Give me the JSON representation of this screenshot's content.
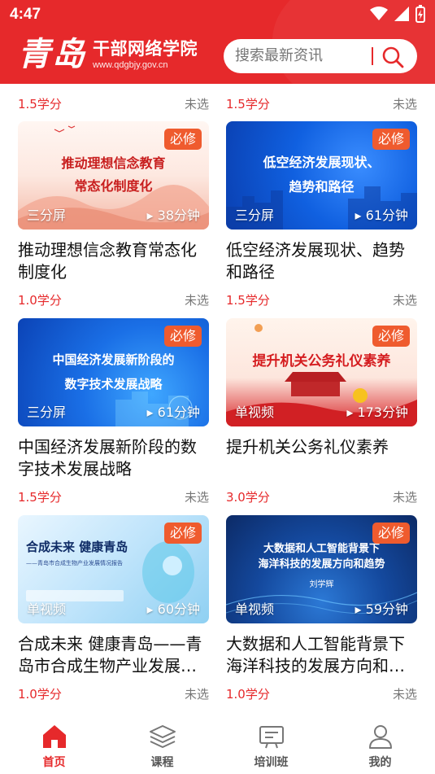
{
  "status_bar": {
    "time": "4:47"
  },
  "header": {
    "logo_mark": "青岛",
    "title": "干部网络学院",
    "url": "www.qdgbjy.gov.cn",
    "search_placeholder": "搜索最新资讯"
  },
  "top_row": [
    {
      "credit": "1.5学分",
      "status": "未选"
    },
    {
      "credit": "1.5学分",
      "status": "未选"
    }
  ],
  "courses": [
    {
      "title": "推动理想信念教育常态化制度化",
      "thumb_text": "推动理想信念教育\n常态化制度化",
      "badge": "必修",
      "type": "三分屏",
      "duration": "▸ 38分钟",
      "credit": "1.0学分",
      "status": "未选"
    },
    {
      "title": "低空经济发展现状、趋势和路径",
      "thumb_text": "低空经济发展现状、\n趋势和路径",
      "badge": "必修",
      "type": "三分屏",
      "duration": "▸ 61分钟",
      "credit": "1.5学分",
      "status": "未选"
    },
    {
      "title": "中国经济发展新阶段的数字技术发展战略",
      "thumb_text": "中国经济发展新阶段的\n数字技术发展战略",
      "badge": "必修",
      "type": "三分屏",
      "duration": "▸ 61分钟",
      "credit": "1.5学分",
      "status": "未选"
    },
    {
      "title": "提升机关公务礼仪素养",
      "thumb_text": "提升机关公务礼仪素养",
      "badge": "必修",
      "type": "单视频",
      "duration": "▸ 173分钟",
      "credit": "3.0学分",
      "status": "未选"
    },
    {
      "title": "合成未来 健康青岛——青岛市合成生物产业发展情况报告",
      "thumb_text": "合成未来 健康青岛",
      "thumb_sub": "——青岛市合成生物产业发展情况报告",
      "badge": "必修",
      "type": "单视频",
      "duration": "▸ 60分钟",
      "credit": "1.0学分",
      "status": "未选"
    },
    {
      "title": "大数据和人工智能背景下海洋科技的发展方向和趋势",
      "thumb_text": "大数据和人工智能背景下\n海洋科技的发展方向和趋势",
      "thumb_sub": "刘学辉",
      "badge": "必修",
      "type": "单视频",
      "duration": "▸ 59分钟",
      "credit": "1.0学分",
      "status": "未选"
    }
  ],
  "bottom_nav": [
    {
      "label": "首页",
      "icon": "home-icon",
      "active": true
    },
    {
      "label": "课程",
      "icon": "layers-icon",
      "active": false
    },
    {
      "label": "培训班",
      "icon": "class-board-icon",
      "active": false
    },
    {
      "label": "我的",
      "icon": "profile-icon",
      "active": false
    }
  ],
  "colors": {
    "brand_red": "#e6292b",
    "badge_orange": "#ef5b2e",
    "meta_gray": "#777777"
  }
}
